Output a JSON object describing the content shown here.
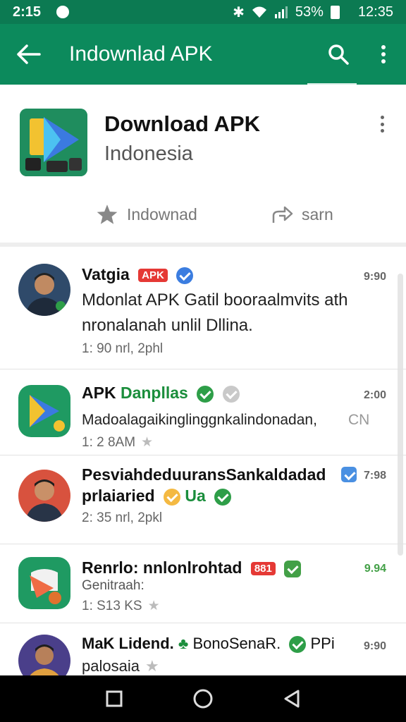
{
  "status_bar": {
    "time": "2:15",
    "battery": "53%",
    "clock": "12:35"
  },
  "app_bar": {
    "title": "Indownlad APK"
  },
  "header": {
    "name": "Download APK",
    "region": "Indonesia",
    "action_follow": "Indownad",
    "action_share": "sarn"
  },
  "messages": [
    {
      "name": "Vatgia",
      "badge": "APK",
      "badge_color": "#e53935",
      "time": "9:90",
      "line1": "Mdonlat APK Gatil booraalmvits ath",
      "line2": "nronalanah unlil Dllina.",
      "meta": "1: 90 nrl, 2phl"
    },
    {
      "name": "APK ",
      "name_green": "Danpllas",
      "time": "2:00",
      "line1": "Madoalagaikinglinggnkalindonadan,",
      "tail": "CN",
      "meta": "1: 2 8AM"
    },
    {
      "name": "PesviahdeduuransSankaldadad",
      "time": "7:98",
      "time_color": "#1b8e3c",
      "line1": "prlaiaried",
      "tail": "Ua",
      "meta": "2: 35 nrl, 2pkl"
    },
    {
      "name": "Renrlo: nnlonlrohtad",
      "badge": "881",
      "badge_color": "#e53935",
      "time": "9.94",
      "time_color": "#43a047",
      "line1": "Genitraah:",
      "meta": "1: S13 KS"
    },
    {
      "name": "MaK Lidend. ",
      "name_green": "BonoSenaR.",
      "name_tail": "PPi",
      "time": "9:90",
      "line1": "palosaia"
    }
  ]
}
